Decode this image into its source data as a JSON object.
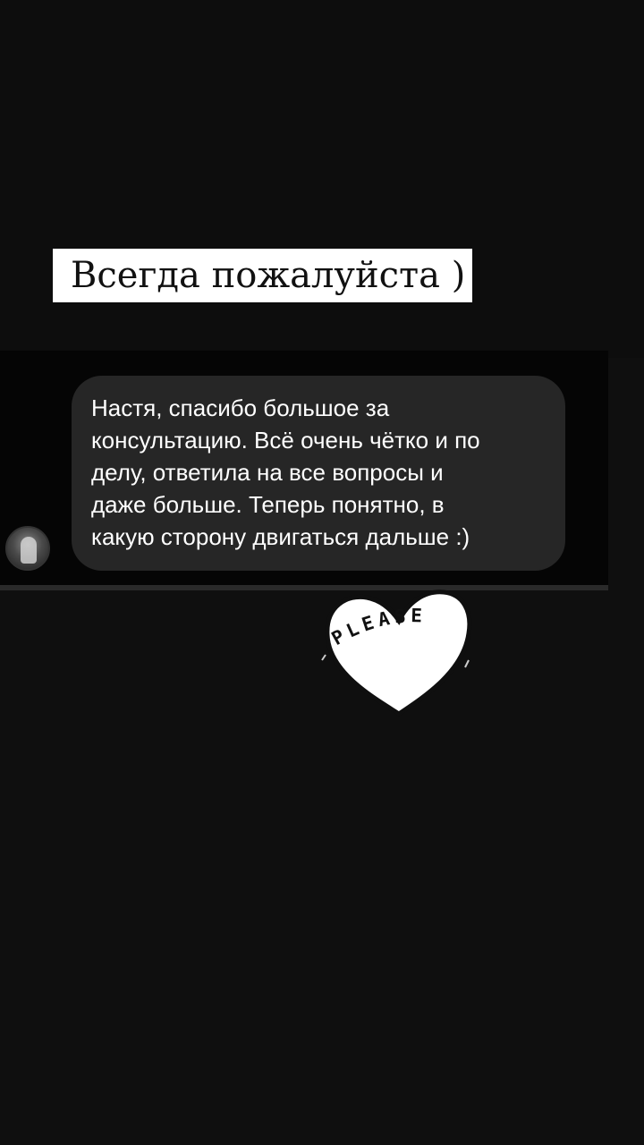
{
  "caption": {
    "text": "Всегда пожалуйста )"
  },
  "message": {
    "text": "Настя, спасибо большое за\nконсультацию. Всё очень чётко и по\nделу, ответила на все  вопросы и\nдаже больше. Теперь понятно, в\nкакую сторону двигаться дальше :)"
  },
  "sticker": {
    "icon": "heart-icon",
    "text": "PLEASE"
  },
  "colors": {
    "background": "#0f0f0f",
    "bubble": "#262626",
    "caption_bg": "#ffffff",
    "text_light": "#ffffff",
    "text_dark": "#111111"
  }
}
